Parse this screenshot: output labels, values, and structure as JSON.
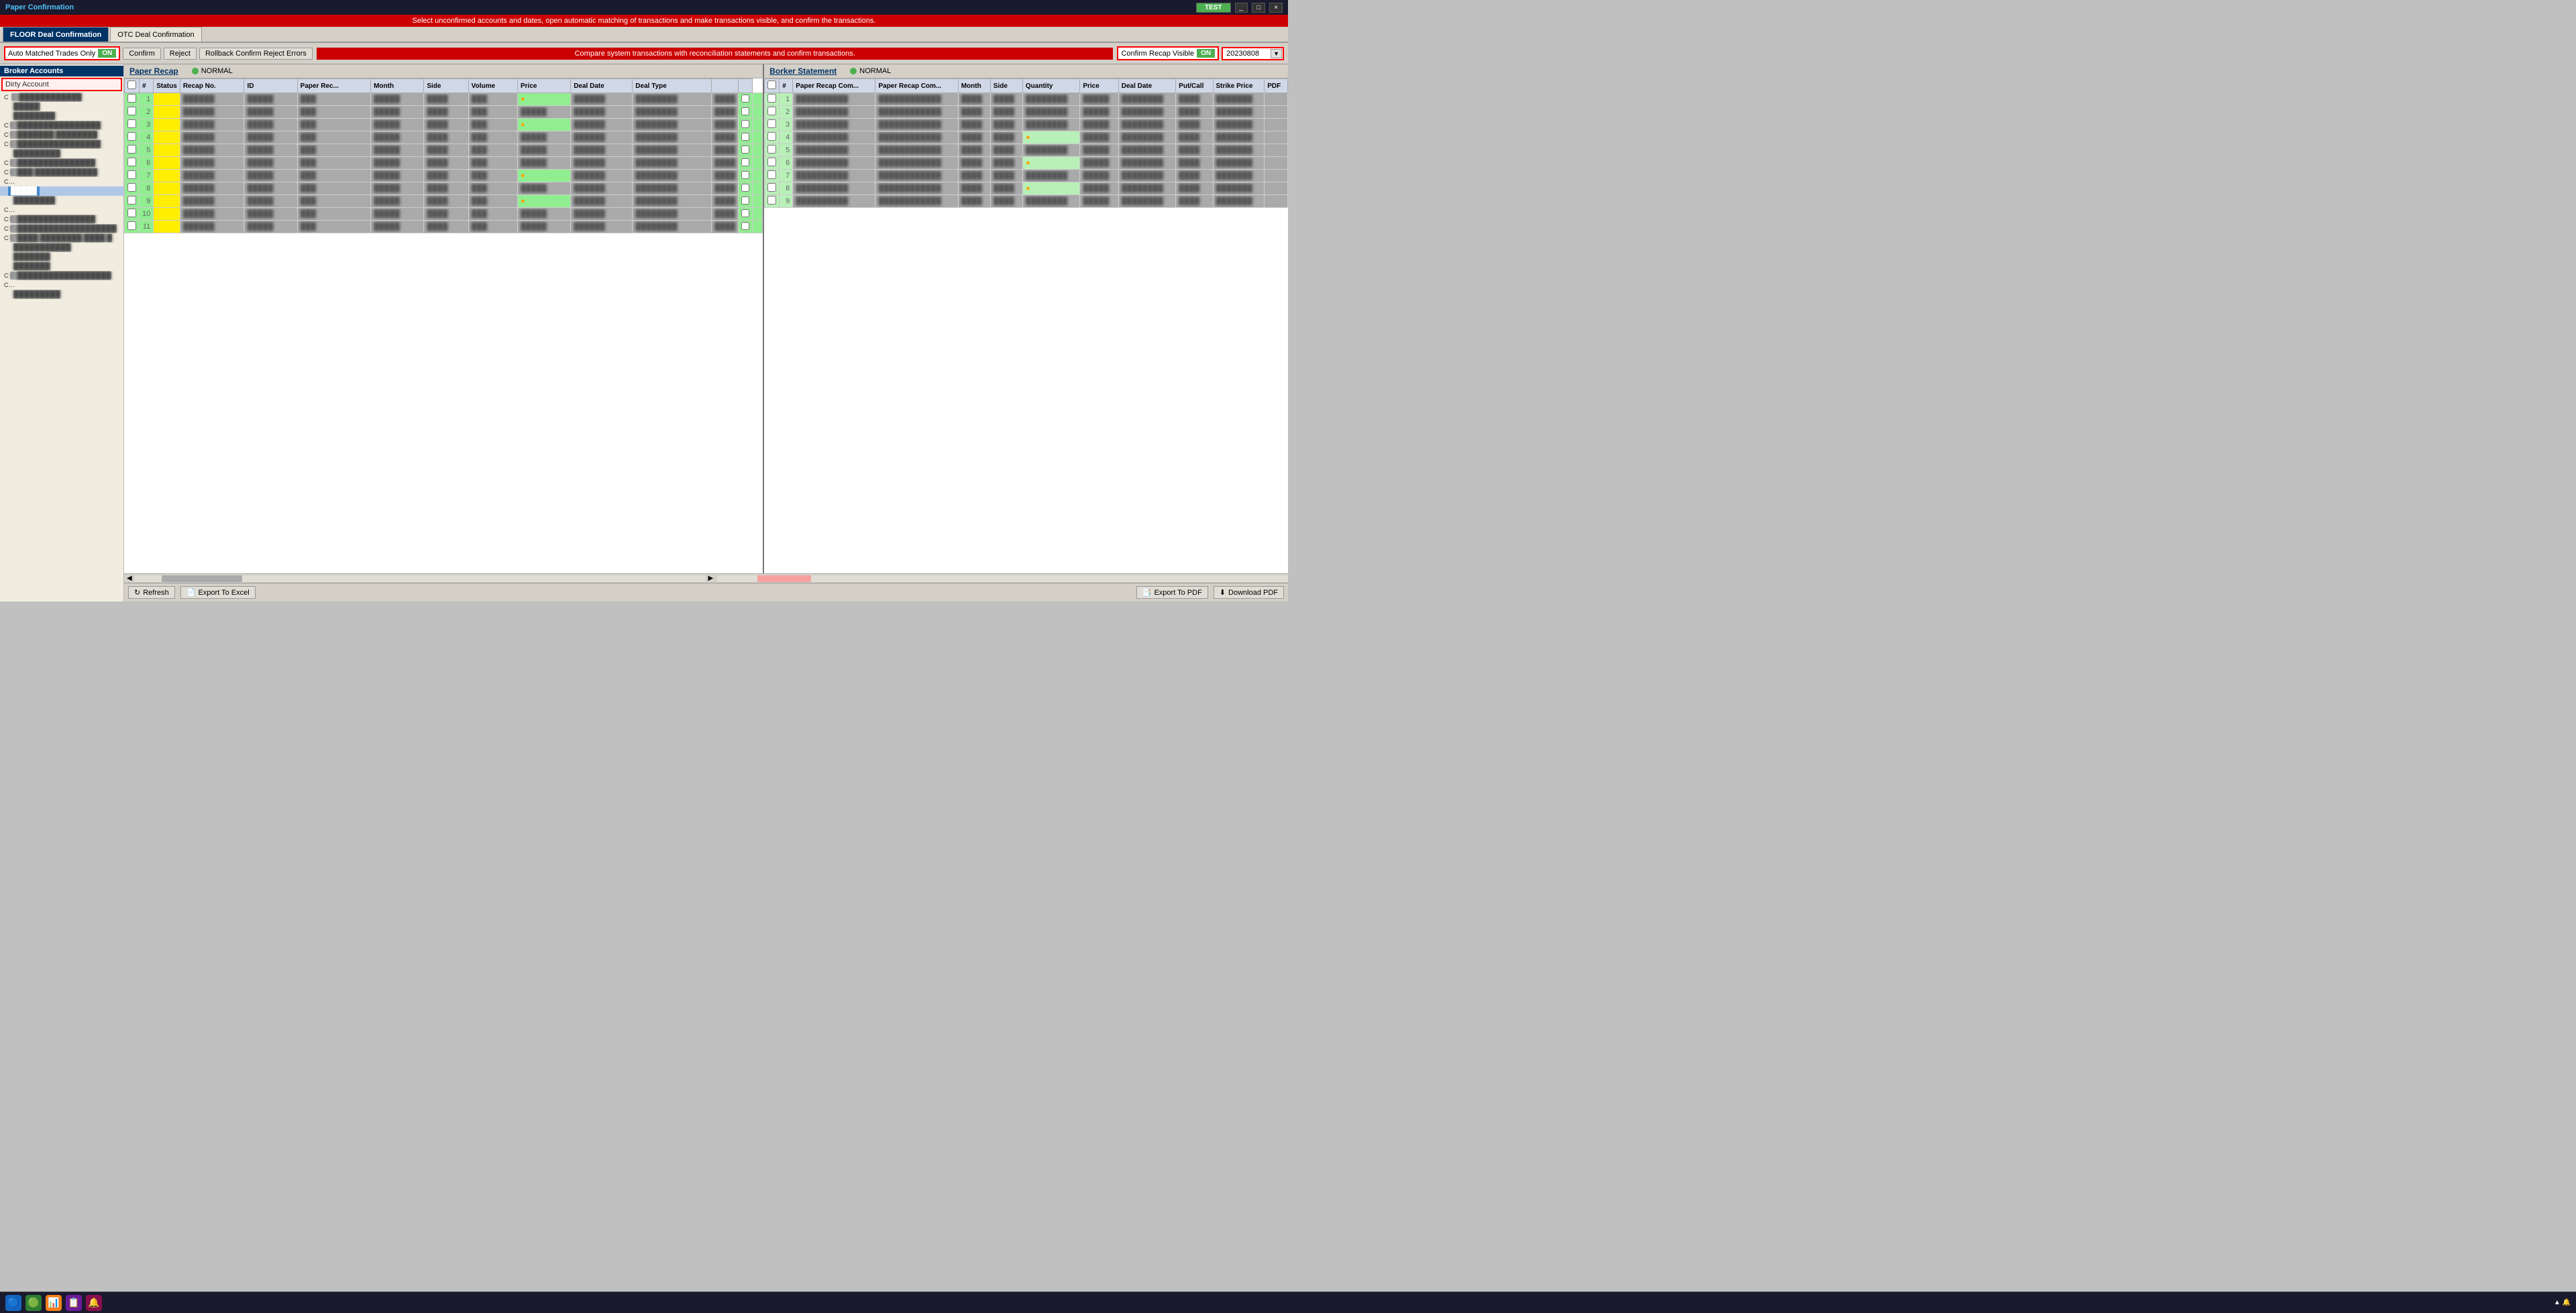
{
  "titleBar": {
    "title": "Paper Confirmation",
    "testLabel": "TEST",
    "windowControls": [
      "_",
      "□",
      "×"
    ]
  },
  "tabs": [
    {
      "label": "FLOOR Deal Confirmation",
      "active": true
    },
    {
      "label": "OTC Deal Confirmation",
      "active": false
    }
  ],
  "toolbar": {
    "autoMatchedLabel": "Auto Matched Trades Only",
    "autoMatchedState": "ON",
    "confirmLabel": "Confirm",
    "rejectLabel": "Reject",
    "rollbackLabel": "Rollback Confirm Reject Errors",
    "confirmRecapLabel": "Confirm Recap Visible",
    "confirmRecapState": "ON",
    "dateValue": "20230808"
  },
  "banners": {
    "top": "Select unconfirmed accounts and dates, open automatic matching of transactions and make transactions visible, and confirm the transactions.",
    "bottom": "Compare system transactions with reconciliation statements and confirm transactions."
  },
  "sidebar": {
    "brokerAccountsLabel": "Broker Accounts",
    "dirtyAccountLabel": "Dirty Account",
    "items": [
      {
        "id": "c1",
        "label": "████████████",
        "type": "c"
      },
      {
        "id": "s1",
        "label": "█████",
        "type": "sub"
      },
      {
        "id": "s2",
        "label": "████████",
        "type": "sub"
      },
      {
        "id": "c2",
        "label": "████████████████",
        "type": "c"
      },
      {
        "id": "c3",
        "label": "███████ ████████",
        "type": "c"
      },
      {
        "id": "c4",
        "label": "████████████████",
        "type": "c"
      },
      {
        "id": "s3",
        "label": "█████████",
        "type": "sub"
      },
      {
        "id": "c5",
        "label": "███████████████",
        "type": "c"
      },
      {
        "id": "c6",
        "label": "███ ████████████",
        "type": "c"
      },
      {
        "id": "c7",
        "label": "████████████ ██████████",
        "type": "c"
      },
      {
        "id": "s4-selected",
        "label": "█████",
        "type": "selected"
      },
      {
        "id": "s5",
        "label": "████████",
        "type": "sub"
      },
      {
        "id": "c8",
        "label": "███████████ █████████",
        "type": "c"
      },
      {
        "id": "c9",
        "label": "███████████████",
        "type": "c"
      },
      {
        "id": "c10",
        "label": "███████████████████",
        "type": "c"
      },
      {
        "id": "c11",
        "label": "████ ████████ ████ █",
        "type": "c"
      },
      {
        "id": "s6",
        "label": "███████████",
        "type": "sub"
      },
      {
        "id": "s7",
        "label": "███████",
        "type": "sub"
      },
      {
        "id": "s8",
        "label": "███████",
        "type": "sub"
      },
      {
        "id": "c12",
        "label": "██████████████████",
        "type": "c"
      },
      {
        "id": "c13",
        "label": "████████ ████████████",
        "type": "c"
      },
      {
        "id": "s9",
        "label": "█████████",
        "type": "sub"
      }
    ]
  },
  "leftPane": {
    "title": "Paper Recap",
    "normalLabel": "NORMAL",
    "columns": [
      "",
      "Status",
      "Recap No.",
      "ID",
      "Paper Rec...",
      "Month",
      "Side",
      "Volume",
      "Price",
      "Deal Date",
      "Deal Type"
    ],
    "rows": [
      {
        "num": 1,
        "status": "yellow",
        "values": [
          "██████",
          "█████",
          "███",
          "█████",
          "████",
          "███",
          "█████",
          "██████",
          "████████",
          "████"
        ]
      },
      {
        "num": 2,
        "status": "yellow",
        "values": [
          "██████",
          "█████",
          "███",
          "█████",
          "████",
          "███",
          "█████",
          "██████",
          "████████",
          "████"
        ]
      },
      {
        "num": 3,
        "status": "yellow",
        "values": [
          "██████",
          "█████",
          "███",
          "█████",
          "████",
          "███",
          "█████",
          "██████",
          "████████",
          "████"
        ]
      },
      {
        "num": 4,
        "status": "yellow",
        "values": [
          "██████",
          "█████",
          "███",
          "█████",
          "████",
          "███",
          "█████",
          "██████",
          "████████",
          "████"
        ]
      },
      {
        "num": 5,
        "status": "yellow",
        "values": [
          "██████",
          "█████",
          "███",
          "█████",
          "████",
          "███",
          "█████",
          "██████",
          "████████",
          "████"
        ]
      },
      {
        "num": 6,
        "status": "yellow",
        "values": [
          "██████",
          "█████",
          "███",
          "█████",
          "████",
          "███",
          "█████",
          "██████",
          "████████",
          "████"
        ]
      },
      {
        "num": 7,
        "status": "yellow",
        "values": [
          "██████",
          "█████",
          "███",
          "█████",
          "████",
          "███",
          "█████",
          "██████",
          "████████",
          "████"
        ]
      },
      {
        "num": 8,
        "status": "yellow",
        "values": [
          "██████",
          "█████",
          "███",
          "█████",
          "████",
          "███",
          "█████",
          "██████",
          "████████",
          "████"
        ]
      },
      {
        "num": 9,
        "status": "yellow",
        "values": [
          "██████",
          "█████",
          "███",
          "█████",
          "████",
          "███",
          "█████",
          "██████",
          "████████",
          "████"
        ]
      },
      {
        "num": 10,
        "status": "yellow",
        "values": [
          "██████",
          "█████",
          "███",
          "█████",
          "████",
          "███",
          "█████",
          "██████",
          "████████",
          "████"
        ]
      },
      {
        "num": 11,
        "status": "yellow",
        "values": [
          "██████",
          "█████",
          "███",
          "█████",
          "████",
          "███",
          "█████",
          "██████",
          "████████",
          "████"
        ]
      }
    ]
  },
  "rightPane": {
    "title": "Borker Statement",
    "normalLabel": "NORMAL",
    "columns": [
      "",
      "Paper Recap Com...",
      "Paper Recap Com...",
      "Month",
      "Side",
      "Quantity",
      "Price",
      "Deal Date",
      "Put/Call",
      "Strike Price",
      "PDF"
    ],
    "rows": [
      {
        "num": 1,
        "values": [
          "██████████",
          "████████████",
          "████",
          "████",
          "████████",
          "█████",
          "████████",
          "████",
          "███████",
          ""
        ]
      },
      {
        "num": 2,
        "values": [
          "██████████",
          "████████████",
          "████",
          "████",
          "████████",
          "█████",
          "████████",
          "████",
          "███████",
          ""
        ]
      },
      {
        "num": 3,
        "values": [
          "██████████",
          "████████████",
          "████",
          "████",
          "████████",
          "█████",
          "████████",
          "████",
          "███████",
          ""
        ]
      },
      {
        "num": 4,
        "values": [
          "██████████",
          "████████████",
          "████",
          "████",
          "████████",
          "█████",
          "████████",
          "████",
          "███████",
          ""
        ]
      },
      {
        "num": 5,
        "values": [
          "██████████",
          "████████████",
          "████",
          "████",
          "████████",
          "█████",
          "████████",
          "████",
          "███████",
          ""
        ]
      },
      {
        "num": 6,
        "values": [
          "██████████",
          "████████████",
          "████",
          "████",
          "████████",
          "█████",
          "████████",
          "████",
          "███████",
          ""
        ]
      },
      {
        "num": 7,
        "values": [
          "██████████",
          "████████████",
          "████",
          "████",
          "████████",
          "█████",
          "████████",
          "████",
          "███████",
          ""
        ]
      },
      {
        "num": 8,
        "values": [
          "██████████",
          "████████████",
          "████",
          "████",
          "████████",
          "█████",
          "████████",
          "████",
          "███████",
          ""
        ]
      },
      {
        "num": 9,
        "values": [
          "██████████",
          "████████████",
          "████",
          "████",
          "████████",
          "█████",
          "████████",
          "████",
          "███████",
          ""
        ]
      }
    ]
  },
  "bottomToolbar": {
    "refreshLabel": "Refresh",
    "exportExcelLabel": "Export To Excel",
    "exportPdfLabel": "Export To PDF",
    "downloadPdfLabel": "Download PDF"
  },
  "taskbar": {
    "icons": [
      "🔵",
      "🟢",
      "🟡",
      "📊",
      "🟣",
      "🟠"
    ]
  }
}
